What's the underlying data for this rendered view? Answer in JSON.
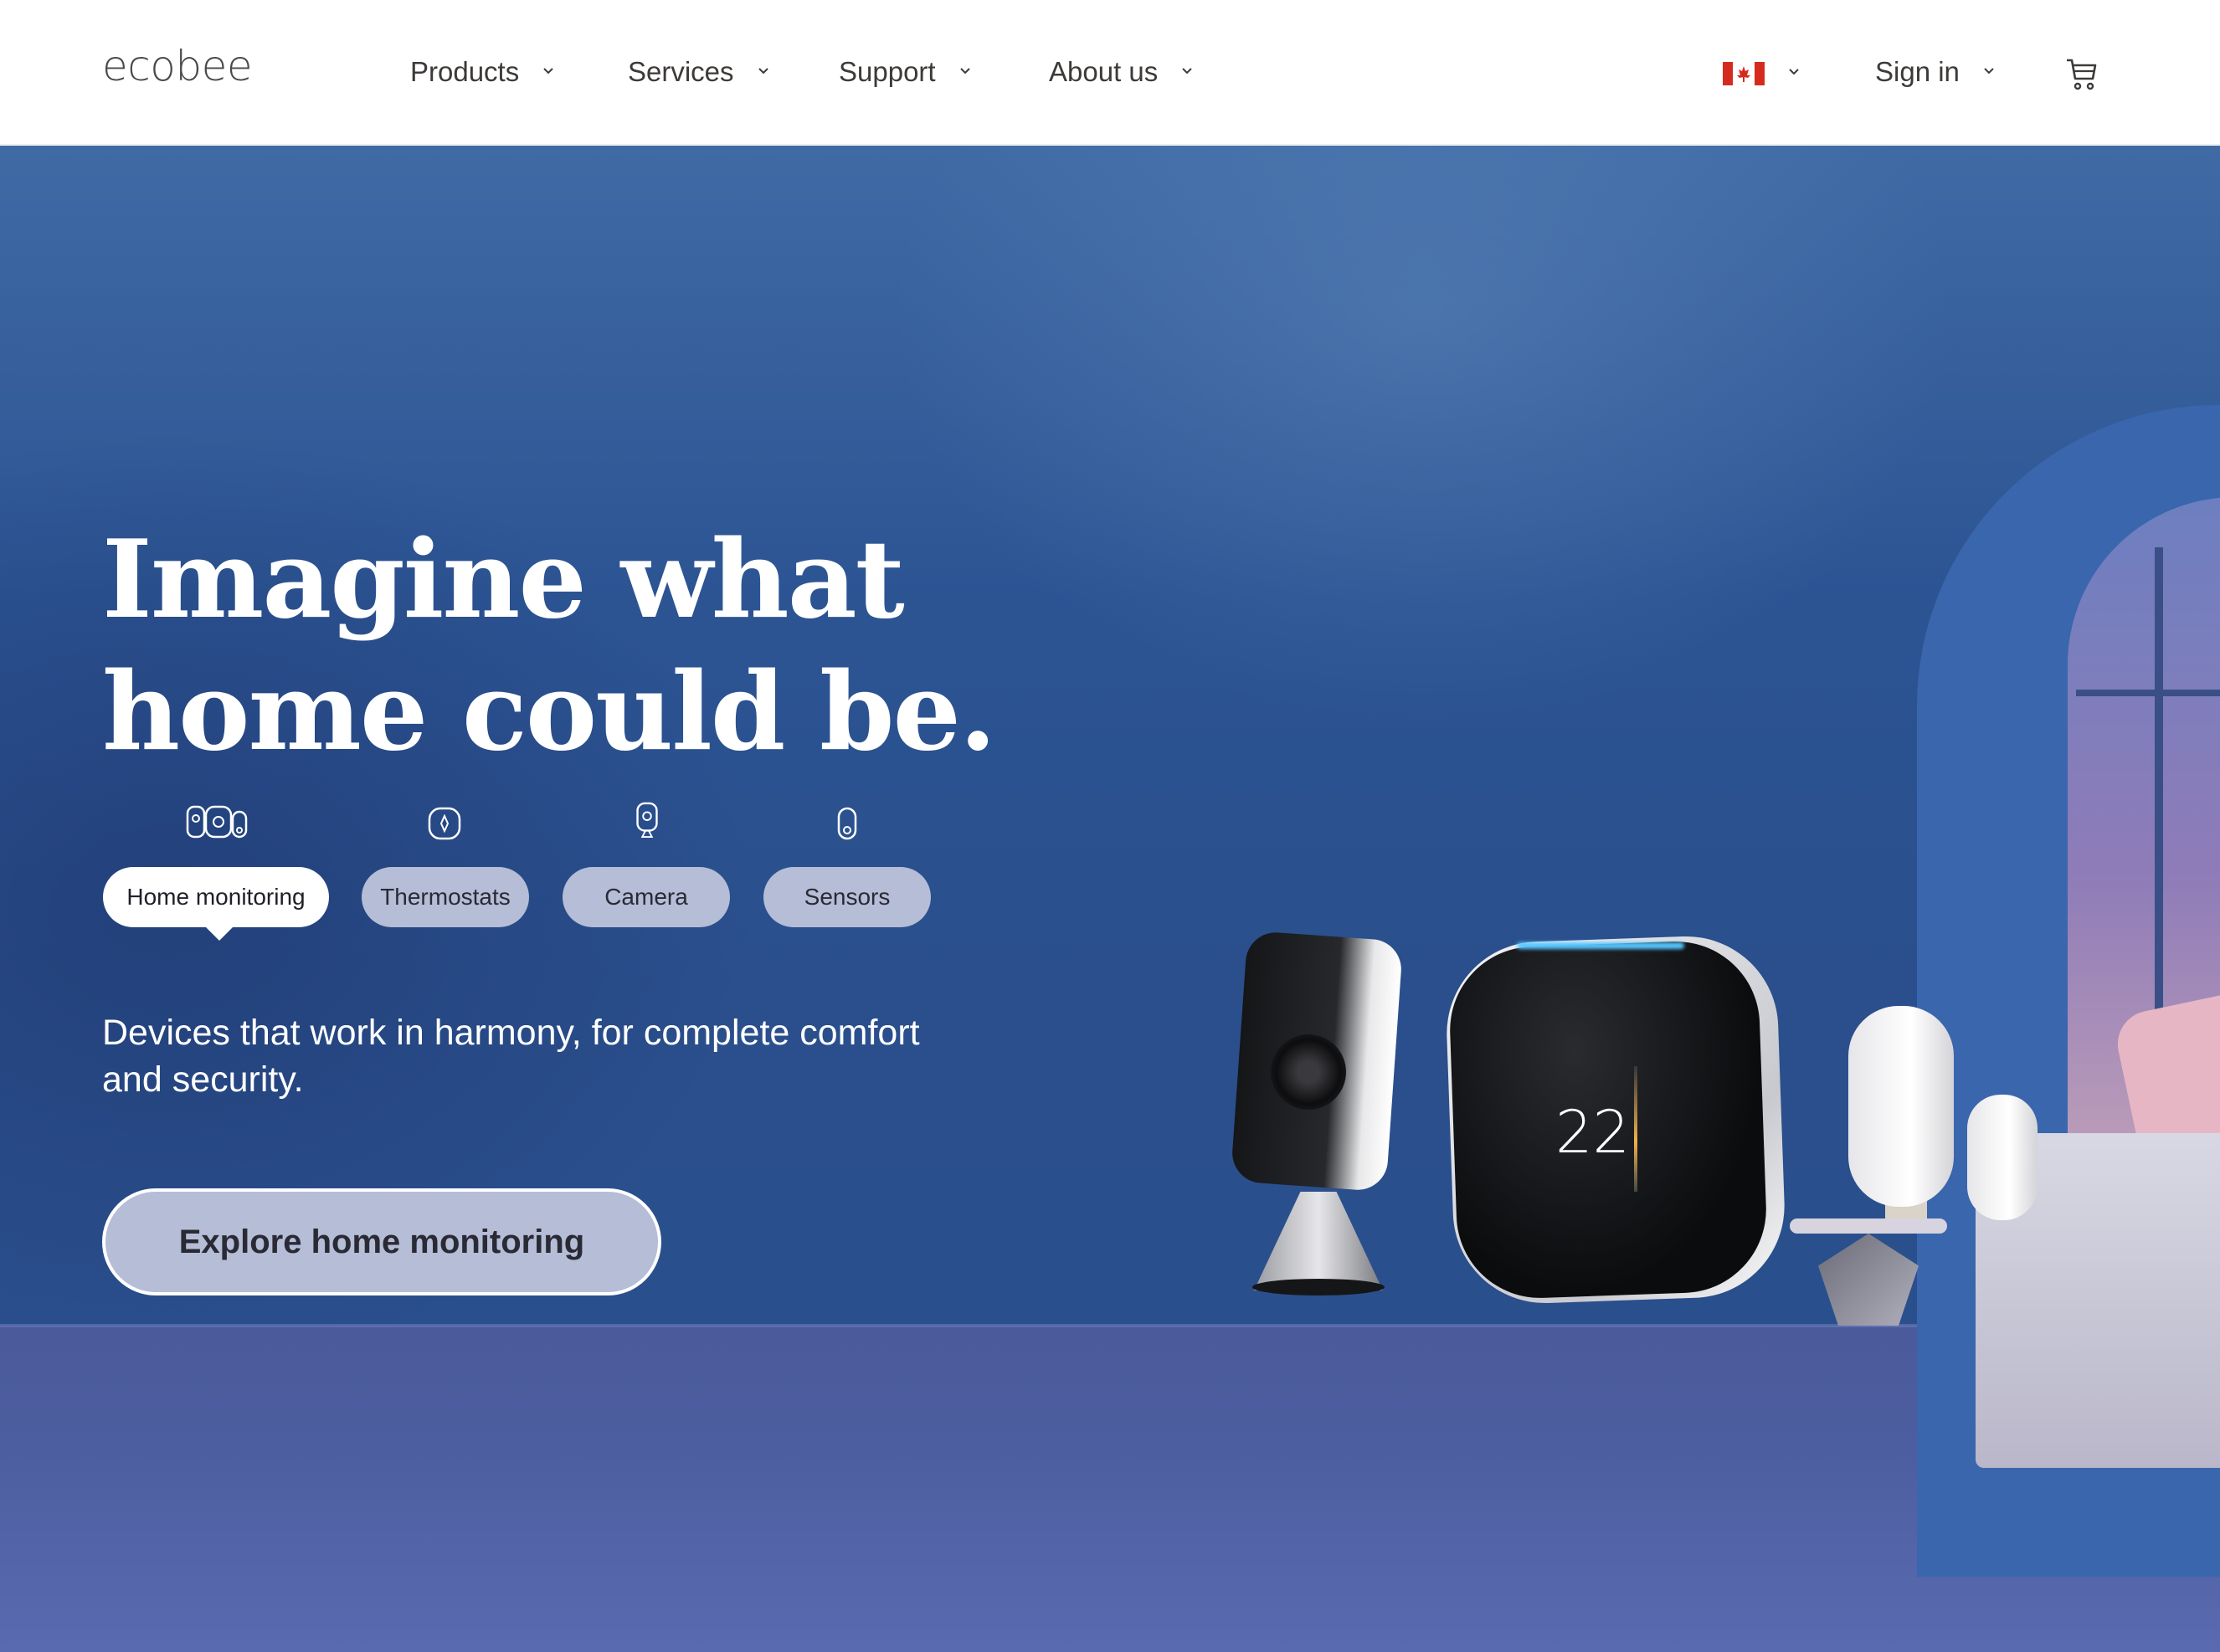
{
  "header": {
    "logo": "ecobee",
    "nav": [
      {
        "label": "Products"
      },
      {
        "label": "Services"
      },
      {
        "label": "Support"
      },
      {
        "label": "About us"
      }
    ],
    "sign_in": "Sign in"
  },
  "hero": {
    "headline_line1": "Imagine what",
    "headline_line2": "home could be.",
    "tabs": [
      {
        "label": "Home monitoring",
        "icon": "home-monitoring-icon",
        "active": true
      },
      {
        "label": "Thermostats",
        "icon": "thermostat-icon",
        "active": false
      },
      {
        "label": "Camera",
        "icon": "camera-icon",
        "active": false
      },
      {
        "label": "Sensors",
        "icon": "sensor-icon",
        "active": false
      }
    ],
    "subtitle": "Devices that work in harmony, for complete comfort and security.",
    "cta_label": "Explore home monitoring",
    "device_display": {
      "temperature": "22"
    }
  }
}
